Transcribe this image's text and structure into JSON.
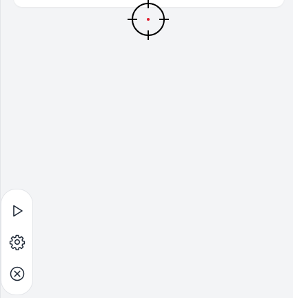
{
  "colors": {
    "background": "#f3f4f6",
    "card": "#ffffff",
    "border": "#e2e4e8",
    "icon_stroke": "#1f2937",
    "crosshair_stroke": "#000000",
    "crosshair_dot": "#e11d2e"
  },
  "crosshair": {
    "icon": "crosshair-cursor-icon"
  },
  "toolbar": {
    "buttons": [
      {
        "id": "play",
        "icon": "play-icon"
      },
      {
        "id": "settings",
        "icon": "gear-icon"
      },
      {
        "id": "close",
        "icon": "close-circle-icon"
      }
    ]
  }
}
